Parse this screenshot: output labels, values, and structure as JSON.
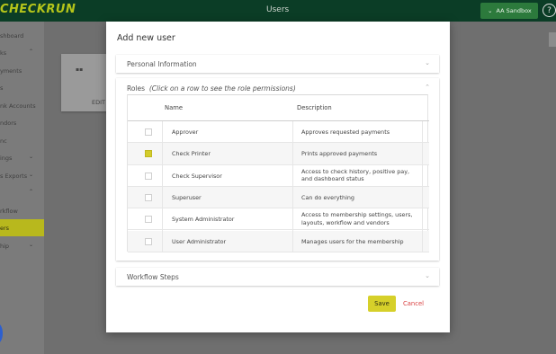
{
  "app": {
    "brand": "CHECKRUN",
    "page_title": "Users",
    "environment_button": "AA Sandbox",
    "help_icon": "question-circle-icon"
  },
  "sidebar": {
    "items": [
      {
        "label": "shboard",
        "chevron": ""
      },
      {
        "label": "ks",
        "chevron": "⌃"
      },
      {
        "label": "yments",
        "chevron": ""
      },
      {
        "label": "s",
        "chevron": ""
      },
      {
        "label": "nk Accounts",
        "chevron": ""
      },
      {
        "label": "ndors",
        "chevron": ""
      },
      {
        "label": "nc",
        "chevron": ""
      },
      {
        "label": "ings",
        "chevron": "⌄"
      },
      {
        "label": "s Exports",
        "chevron": "⌄"
      },
      {
        "label": "",
        "chevron": "⌃"
      },
      {
        "label": "rkflow",
        "chevron": ""
      },
      {
        "label": "ers",
        "chevron": ""
      },
      {
        "label": "hip",
        "chevron": "⌄"
      }
    ]
  },
  "background_card": {
    "edit_label": "EDIT"
  },
  "modal": {
    "title": "Add new user",
    "personal_section": "Personal Information",
    "roles_section": "Roles",
    "roles_hint": "(Click on a row to see the role permissions)",
    "workflow_section": "Workflow Steps",
    "table": {
      "columns": [
        "Name",
        "Description"
      ],
      "rows": [
        {
          "name": "Approver",
          "description": "Approves requested payments",
          "checked": false
        },
        {
          "name": "Check Printer",
          "description": "Prints approved payments",
          "checked": true
        },
        {
          "name": "Check Supervisor",
          "description": "Access to check history, positive pay, and dashboard status",
          "checked": false
        },
        {
          "name": "Superuser",
          "description": "Can do everything",
          "checked": false
        },
        {
          "name": "System Administrator",
          "description": "Access to membership settings, users, layouts, workflow and vendors",
          "checked": false
        },
        {
          "name": "User Administrator",
          "description": "Manages users for the membership",
          "checked": false
        }
      ]
    },
    "save_label": "Save",
    "cancel_label": "Cancel"
  },
  "colors": {
    "topbar": "#0b3d26",
    "brand": "#b5c51a",
    "accent": "#d6d02a",
    "cancel": "#d94040"
  }
}
